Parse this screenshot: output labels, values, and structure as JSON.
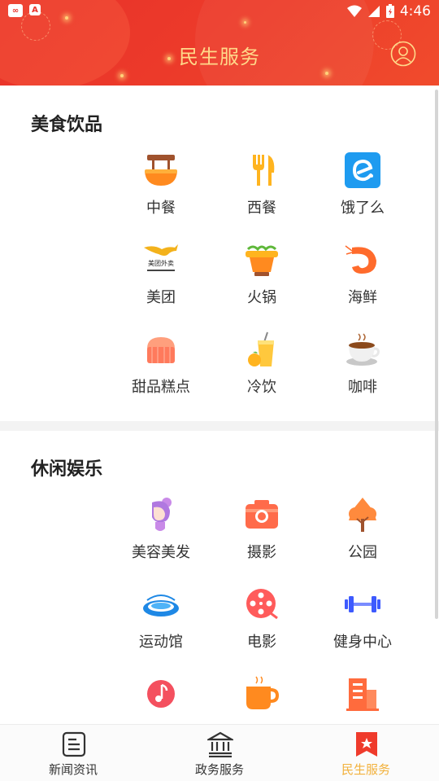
{
  "status_bar": {
    "time": "4:46"
  },
  "header": {
    "title": "民生服务"
  },
  "sections": [
    {
      "title": "美食饮品",
      "items": [
        {
          "label": "中餐",
          "icon": "noodle-bowl-icon"
        },
        {
          "label": "西餐",
          "icon": "fork-knife-icon"
        },
        {
          "label": "饿了么",
          "icon": "eleme-icon"
        },
        {
          "label": "美团",
          "icon": "meituan-kangaroo-icon"
        },
        {
          "label": "火锅",
          "icon": "hotpot-icon"
        },
        {
          "label": "海鲜",
          "icon": "shrimp-icon"
        },
        {
          "label": "甜品糕点",
          "icon": "cake-icon"
        },
        {
          "label": "冷饮",
          "icon": "cold-drink-icon"
        },
        {
          "label": "咖啡",
          "icon": "coffee-cup-icon"
        }
      ]
    },
    {
      "title": "休闲娱乐",
      "items": [
        {
          "label": "美容美发",
          "icon": "beauty-salon-icon"
        },
        {
          "label": "摄影",
          "icon": "camera-icon"
        },
        {
          "label": "公园",
          "icon": "tree-icon"
        },
        {
          "label": "运动馆",
          "icon": "stadium-icon"
        },
        {
          "label": "电影",
          "icon": "film-reel-icon"
        },
        {
          "label": "健身中心",
          "icon": "dumbbell-icon"
        },
        {
          "label": "",
          "icon": "music-note-icon"
        },
        {
          "label": "",
          "icon": "tea-cup-icon"
        },
        {
          "label": "",
          "icon": "building-icon"
        }
      ]
    }
  ],
  "meituan_logo_text": "美团外卖",
  "tabs": [
    {
      "label": "新闻资讯",
      "icon": "news-icon",
      "active": false
    },
    {
      "label": "政务服务",
      "icon": "government-icon",
      "active": false
    },
    {
      "label": "民生服务",
      "icon": "bookmark-star-icon",
      "active": true
    }
  ],
  "colors": {
    "header_red": "#e8322a",
    "title_gold": "#ffd98a",
    "active_tab": "#f2b13c"
  }
}
